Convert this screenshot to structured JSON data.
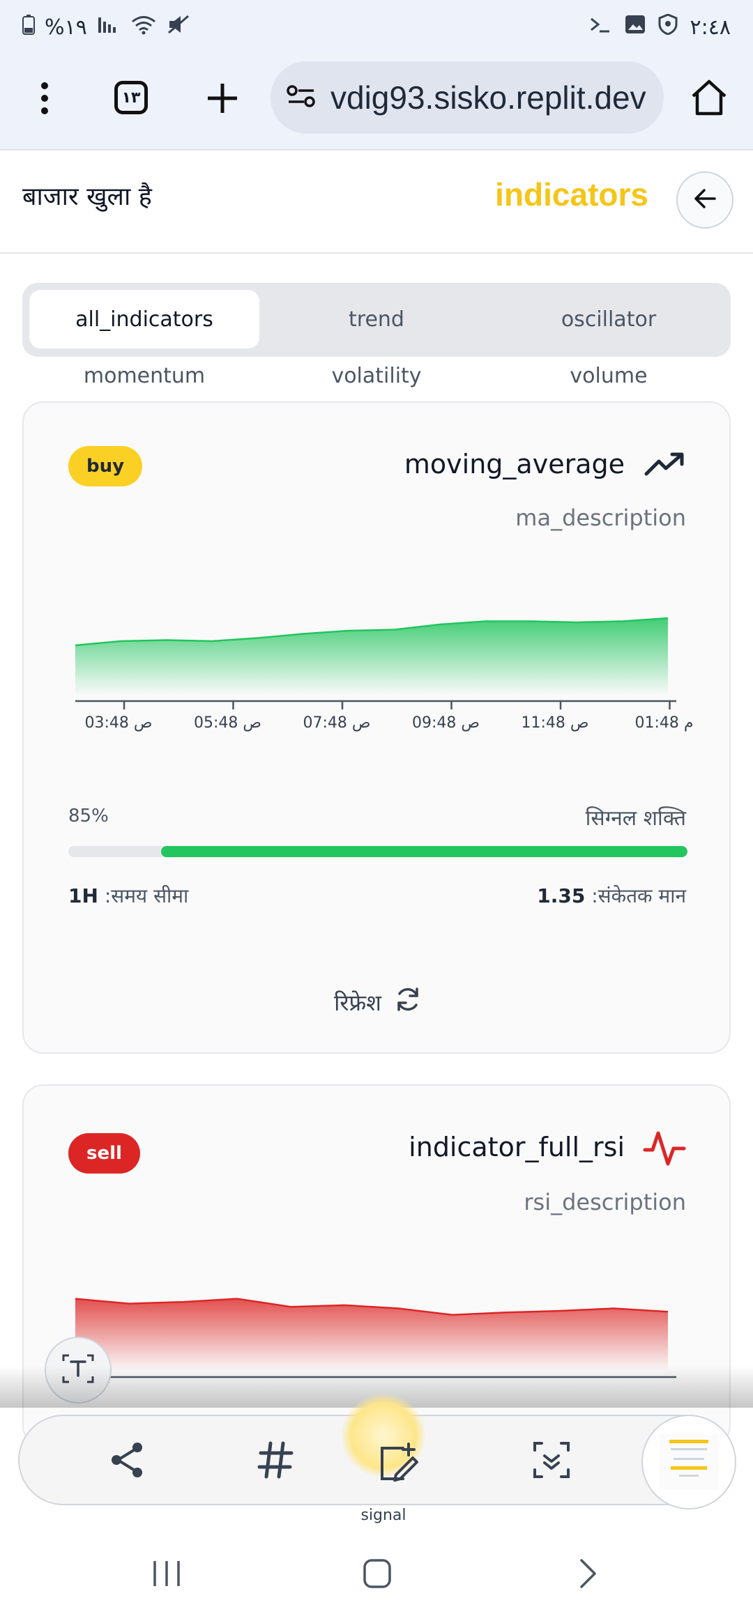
{
  "status_bar": {
    "battery": "%١٩",
    "time": "٢:٤٨"
  },
  "browser": {
    "url": "vdig93.sisko.replit.dev",
    "tab_count": "١٣"
  },
  "header": {
    "market_status": "बाजार खुला है",
    "title": "indicators"
  },
  "tabs": {
    "row1": [
      "all_indicators",
      "trend",
      "oscillator"
    ],
    "row2": [
      "momentum",
      "volatility",
      "volume"
    ],
    "active": "all_indicators"
  },
  "cards": [
    {
      "badge": "buy",
      "title": "moving_average",
      "description": "ma_description",
      "strength_label": "सिग्नल शक्ति",
      "strength_percent": "85%",
      "strength_value": 0.85,
      "timeframe_label": ":समय सीमा",
      "timeframe_value": "1H",
      "indicator_label": ":संकेतक मान",
      "indicator_value": "1.35",
      "refresh_label": "रिफ्रेश",
      "color": "#22c55e"
    },
    {
      "badge": "sell",
      "title": "indicator_full_rsi",
      "description": "rsi_description",
      "color": "#dc2626"
    }
  ],
  "chart_data": [
    {
      "type": "area",
      "x": [
        "03:48 ص",
        "05:48 ص",
        "07:48 ص",
        "09:48 ص",
        "11:48 ص",
        "01:48 م"
      ],
      "values": [
        0.48,
        0.52,
        0.53,
        0.52,
        0.55,
        0.59,
        0.62,
        0.63,
        0.68,
        0.71,
        0.71,
        0.7,
        0.71,
        0.74
      ],
      "series_color": "#22c55e"
    },
    {
      "type": "area",
      "values": [
        0.9,
        0.84,
        0.86,
        0.9,
        0.8,
        0.82,
        0.78,
        0.7,
        0.73,
        0.75,
        0.78,
        0.74
      ],
      "series_color": "#dc2626"
    }
  ],
  "toolbar": {
    "fab_label": "signal"
  },
  "colors": {
    "accent": "#f5c518",
    "buy": "#fbd024",
    "sell": "#dc2626",
    "positive": "#22c55e"
  }
}
